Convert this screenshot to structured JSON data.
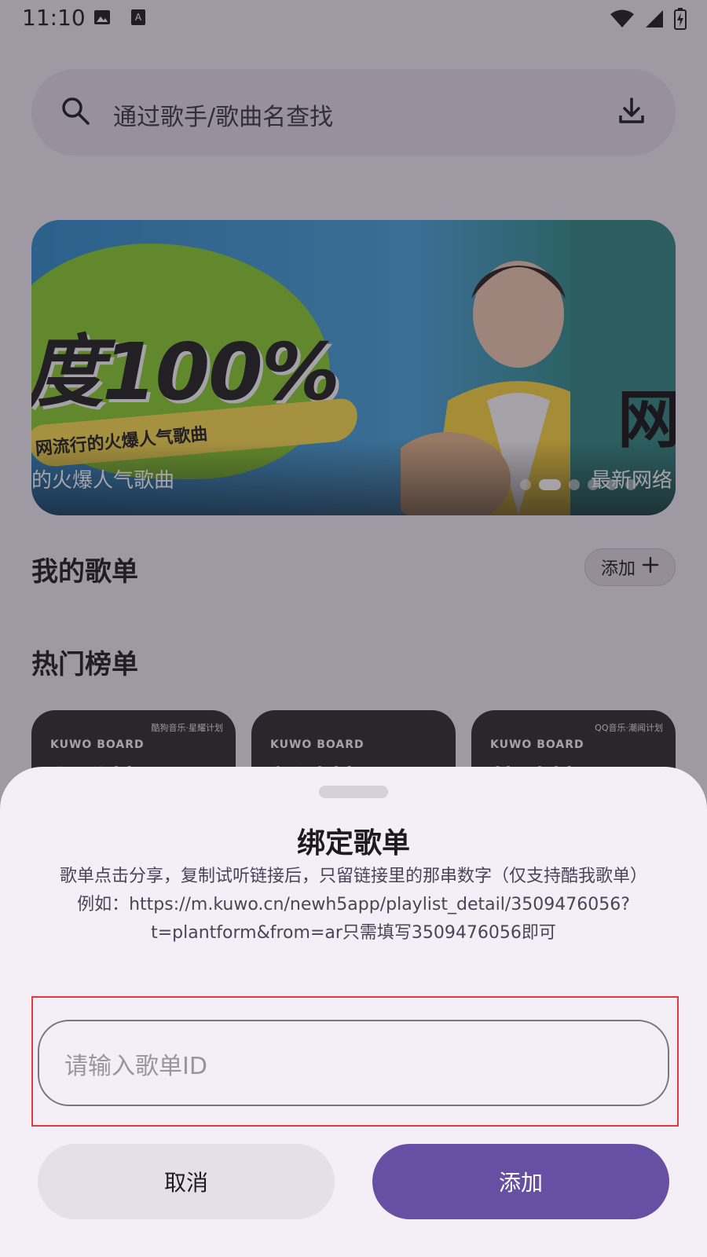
{
  "status_bar": {
    "time": "11:10"
  },
  "search": {
    "placeholder": "通过歌手/歌曲名查找"
  },
  "banner": {
    "headline": "度100%",
    "arc_text": "网流行的火爆人气歌曲",
    "right_glyph": "网",
    "caption_left": "的火爆人气歌曲",
    "caption_right": "最新网络",
    "pages": 7,
    "active_page": 2
  },
  "my_playlists": {
    "title": "我的歌单",
    "add_label": "添加"
  },
  "hot_charts": {
    "title": "热门榜单",
    "cards": [
      {
        "brand": "KUWO BOARD",
        "tag": "酷狗音乐·星耀计划",
        "title": "飙升榜"
      },
      {
        "brand": "KUWO BOARD",
        "tag": "",
        "title": "新歌榜"
      },
      {
        "brand": "KUWO BOARD",
        "tag": "QQ音乐·潮闻计划",
        "title": "热歌榜"
      }
    ]
  },
  "dialog": {
    "title": "绑定歌单",
    "description_line1": "歌单点击分享，复制试听链接后，只留链接里的那串数字（仅支持酷我歌单）",
    "description_line2": "例如：https://m.kuwo.cn/newh5app/playlist_detail/3509476056?t=plantform&from=ar只需填写3509476056即可",
    "input_placeholder": "请输入歌单ID",
    "cancel_label": "取消",
    "add_label": "添加"
  },
  "colors": {
    "primary": "#6750a4",
    "highlight": "#e03b3b"
  }
}
